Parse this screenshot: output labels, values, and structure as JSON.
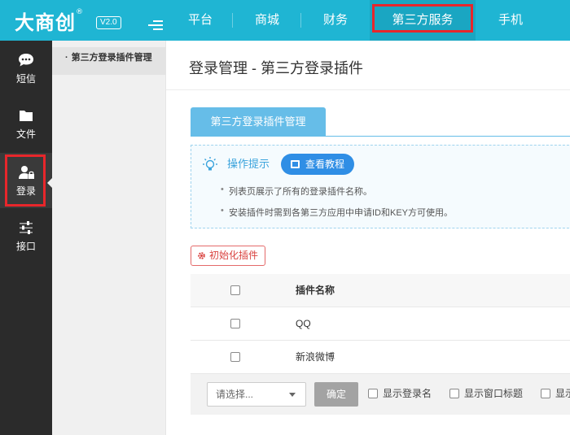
{
  "header": {
    "logo": "大商创",
    "logo_mark": "®",
    "version": "V2.0",
    "nav": [
      {
        "label": "平台"
      },
      {
        "label": "商城"
      },
      {
        "label": "财务"
      },
      {
        "label": "第三方服务"
      },
      {
        "label": "手机"
      }
    ],
    "active_nav": "第三方服务"
  },
  "sidebar": {
    "items": [
      {
        "label": "短信",
        "icon": "chat-icon"
      },
      {
        "label": "文件",
        "icon": "folder-icon"
      },
      {
        "label": "登录",
        "icon": "user-lock-icon"
      },
      {
        "label": "接口",
        "icon": "sliders-icon"
      }
    ],
    "active": "登录"
  },
  "subnav": {
    "items": [
      {
        "label": "第三方登录插件管理"
      }
    ]
  },
  "main": {
    "title": "登录管理 - 第三方登录插件",
    "tab": "第三方登录插件管理",
    "tips": {
      "title": "操作提示",
      "button": "查看教程",
      "lines": [
        "列表页展示了所有的登录插件名称。",
        "安装插件时需到各第三方应用中申请ID和KEY方可使用。"
      ]
    },
    "init_button": "初始化插件",
    "table": {
      "header": "插件名称",
      "rows": [
        {
          "name": "QQ"
        },
        {
          "name": "新浪微博"
        }
      ]
    },
    "footer": {
      "select_placeholder": "请选择...",
      "ok": "确定",
      "options": [
        "显示登录名",
        "显示窗口标题",
        "显示"
      ]
    }
  },
  "colors": {
    "topbar": "#1fb5d3",
    "sidebar": "#2b2b2b",
    "highlight": "#e8262b",
    "tab": "#66bde8",
    "tutorial": "#2f8ee5"
  }
}
